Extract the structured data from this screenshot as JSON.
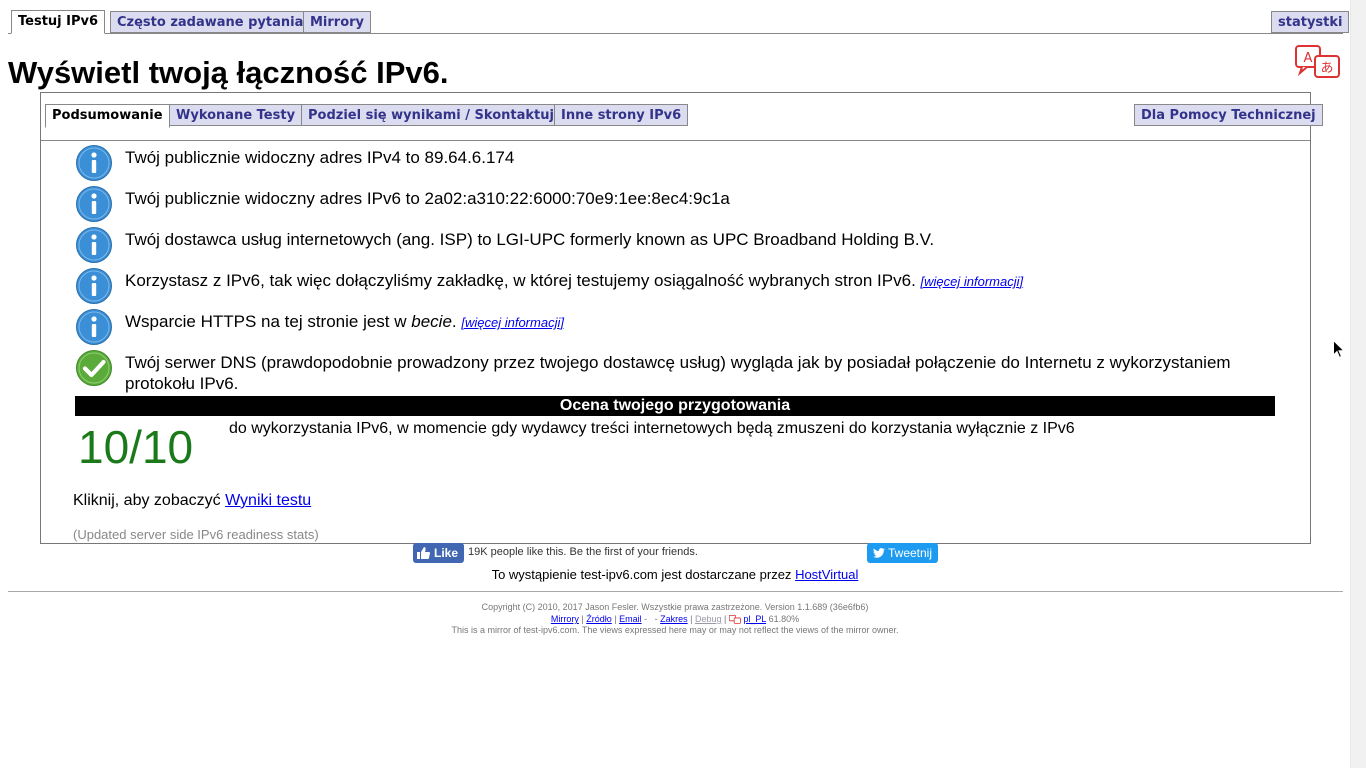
{
  "top_tabs": {
    "test": "Testuj IPv6",
    "faq": "Często zadawane pytania",
    "mirrors": "Mirrory",
    "stats": "statystki"
  },
  "page_title": "Wyświetl twoją łączność IPv6.",
  "inner_tabs": {
    "summary": "Podsumowanie",
    "tests": "Wykonane Testy",
    "share": "Podziel się wynikami / Skontaktuj",
    "other": "Inne strony IPv6",
    "helpdesk": "Dla Pomocy Technicznej"
  },
  "results": [
    {
      "icon": "info-icon",
      "text": "Twój publicznie widoczny adres IPv4 to 89.64.6.174"
    },
    {
      "icon": "info-icon",
      "text": "Twój publicznie widoczny adres IPv6 to 2a02:a310:22:6000:70e9:1ee:8ec4:9c1a"
    },
    {
      "icon": "info-icon",
      "text": "Twój dostawca usług internetowych (ang. ISP) to LGI-UPC formerly known as UPC Broadband Holding B.V."
    },
    {
      "icon": "info-icon",
      "text": "Korzystasz z IPv6, tak więc dołączyliśmy zakładkę, w której testujemy osiągalność wybranych stron IPv6.",
      "more": "[więcej informacji]"
    },
    {
      "icon": "info-icon",
      "text_before": "Wsparcie HTTPS na tej stronie jest w ",
      "text_em": "becie",
      "text_after": ".",
      "more": "[więcej informacji]"
    },
    {
      "icon": "check-icon",
      "text": "Twój serwer DNS (prawdopodobnie prowadzony przez twojego dostawcę usług) wygląda jak by posiadał połączenie do Internetu z wykorzystaniem protokołu IPv6."
    }
  ],
  "readiness": {
    "header": "Ocena twojego przygotowania",
    "score": "10/10",
    "description": "do wykorzystania IPv6, w momencie gdy wydawcy treści internetowych będą zmuszeni do korzystania wyłącznie z IPv6"
  },
  "click_prefix": "Kliknij, aby zobaczyć",
  "click_link": "Wyniki testu",
  "updated_stats": "(Updated server side IPv6 readiness stats)",
  "social": {
    "like_label": "Like",
    "like_text": "19K people like this. Be the first of your friends.",
    "tweet_label": "Tweetnij"
  },
  "host_prefix": "To wystąpienie test-ipv6.com jest dostarczane przez",
  "host_link": "HostVirtual",
  "footer": {
    "copyright": "Copyright (C) 2010, 2017 Jason Fesler. Wszystkie prawa zastrzeżone. Version 1.1.689 (36e6fb6)",
    "links": {
      "mirrors": "Mirrory",
      "source": "Źródło",
      "email": "Email",
      "dash": "-",
      "scope": "Zakres",
      "debug": "Debug",
      "locale": "pl_PL",
      "percent": "61.80%"
    },
    "mirror_note": "This is a mirror of test-ipv6.com. The views expressed here may or may not reflect the views of the mirror owner."
  },
  "colors": {
    "tab_bg": "#dcdcf0",
    "tab_text": "#33338a",
    "score": "#1a7a1a",
    "info_blue": "#3a8fd6",
    "check_green": "#5aab3a",
    "link": "#0000ee"
  }
}
